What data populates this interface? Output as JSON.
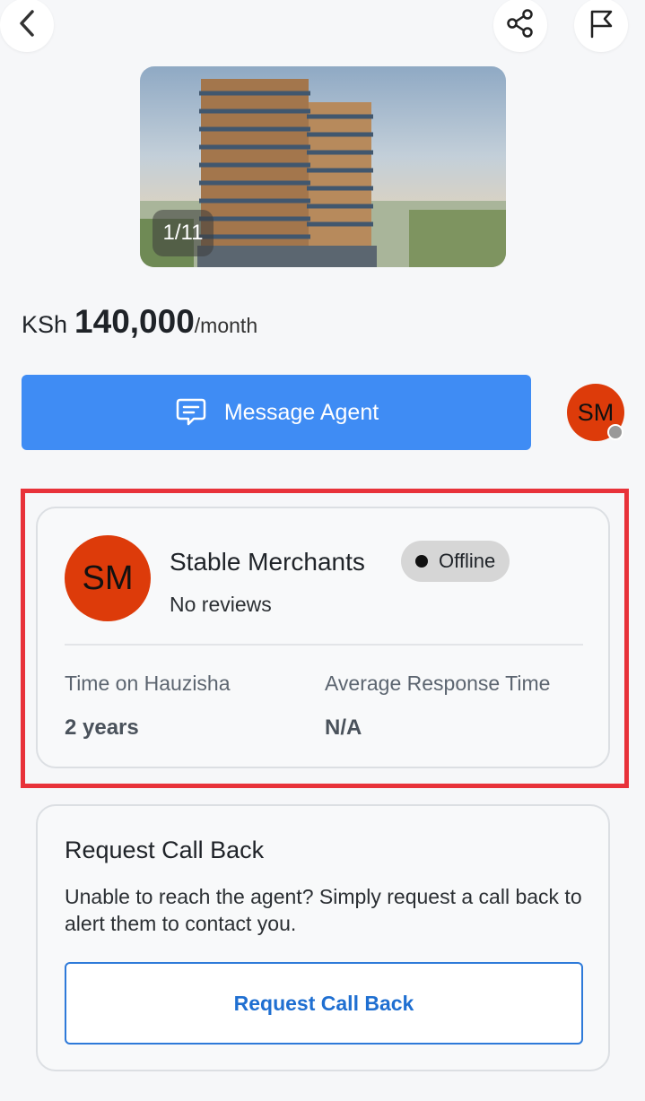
{
  "header": {
    "back_icon": "chevron-left-icon",
    "share_icon": "share-icon",
    "flag_icon": "flag-icon"
  },
  "gallery": {
    "counter": "1/11"
  },
  "price": {
    "currency": "KSh",
    "amount": "140,000",
    "period": "/month"
  },
  "actions": {
    "message_label": "Message Agent",
    "agent_initials": "SM"
  },
  "agent": {
    "initials": "SM",
    "name": "Stable Merchants",
    "status": "Offline",
    "reviews": "No reviews",
    "time_label": "Time on Hauzisha",
    "time_value": "2 years",
    "response_label": "Average Response Time",
    "response_value": "N/A"
  },
  "callback": {
    "title": "Request Call Back",
    "description": "Unable to reach the agent? Simply request a call back to alert them to contact you.",
    "button_label": "Request Call Back"
  },
  "colors": {
    "primary": "#3f8cf4",
    "avatar": "#dd3b0a",
    "highlight": "#e8323a",
    "link": "#1f6fd1"
  }
}
